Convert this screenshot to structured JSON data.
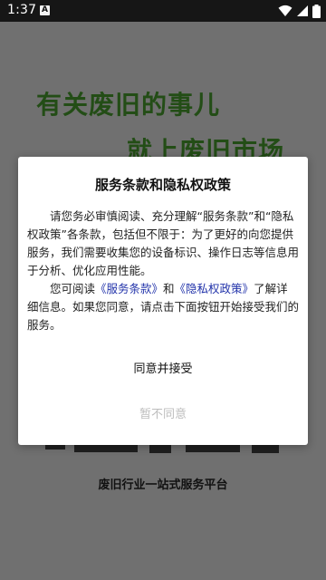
{
  "status_bar": {
    "time": "1:37",
    "notification_icon": "A"
  },
  "background": {
    "headline_line1": "有关废旧的事儿",
    "headline_line2": "就上废旧市场",
    "tagline": "废旧行业一站式服务平台",
    "accent_color": "#234d16"
  },
  "dialog": {
    "title": "服务条款和隐私权政策",
    "para1": "请您务必审慎阅读、充分理解“服务条款”和“隐私权政策”各条款，包括但不限于：为了更好的向您提供服务，我们需要收集您的设备标识、操作日志等信息用于分析、优化应用性能。",
    "para2_prefix": "您可阅读",
    "link_terms": "《服务条款》",
    "para2_and": "和",
    "link_privacy": "《隐私权政策》",
    "para2_suffix": "了解详细信息。如果您同意，请点击下面按钮开始接受我们的服务。",
    "agree_label": "同意并接受",
    "disagree_label": "暂不同意",
    "link_color": "#2233aa"
  }
}
